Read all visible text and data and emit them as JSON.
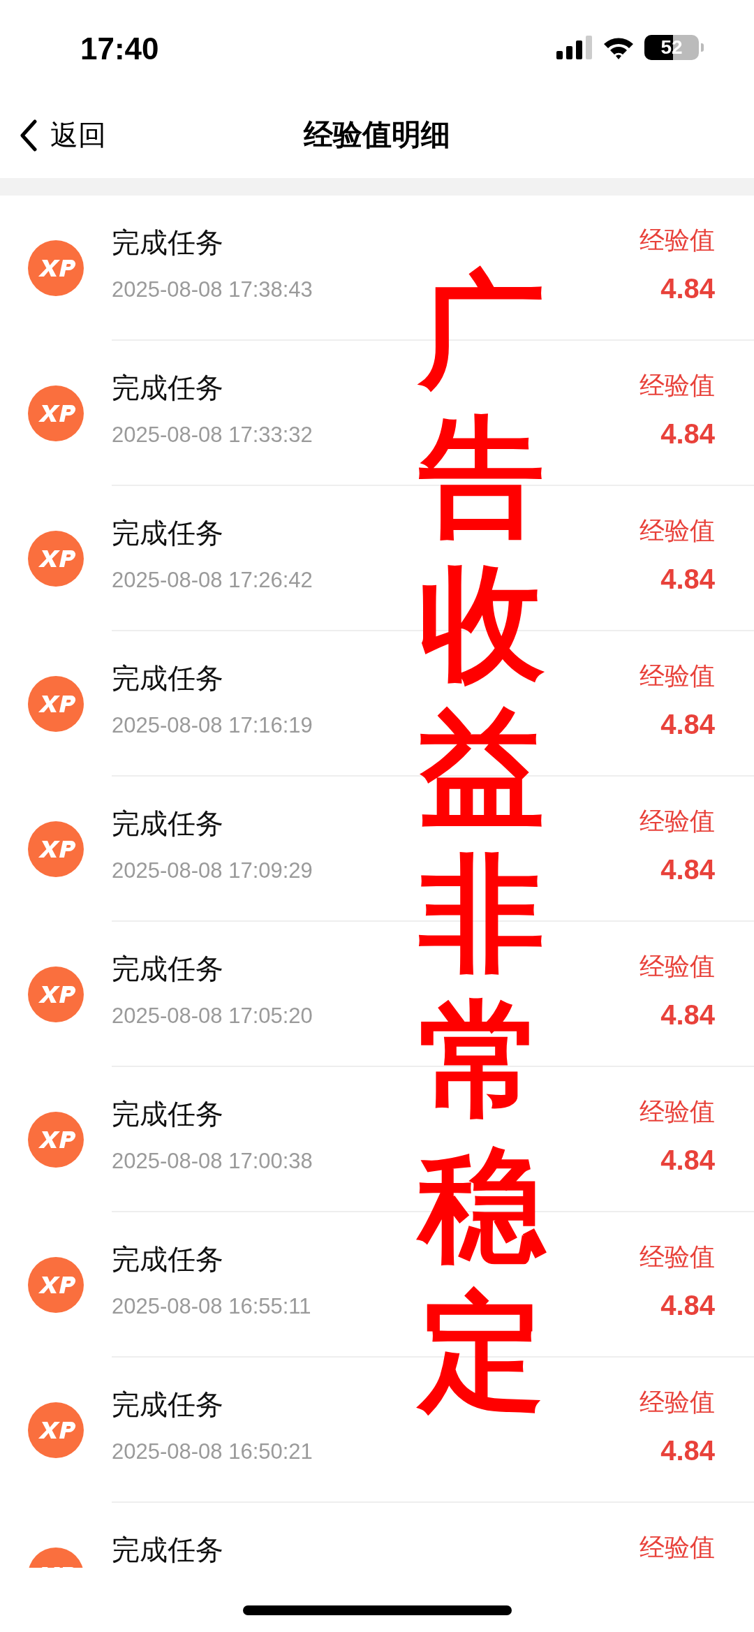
{
  "status_bar": {
    "time": "17:40",
    "battery": "52"
  },
  "nav": {
    "back": "返回",
    "title": "经验值明细"
  },
  "records": [
    {
      "title": "完成任务",
      "date": "2025-08-08 17:38:43",
      "label": "经验值",
      "value": "4.84"
    },
    {
      "title": "完成任务",
      "date": "2025-08-08 17:33:32",
      "label": "经验值",
      "value": "4.84"
    },
    {
      "title": "完成任务",
      "date": "2025-08-08 17:26:42",
      "label": "经验值",
      "value": "4.84"
    },
    {
      "title": "完成任务",
      "date": "2025-08-08 17:16:19",
      "label": "经验值",
      "value": "4.84"
    },
    {
      "title": "完成任务",
      "date": "2025-08-08 17:09:29",
      "label": "经验值",
      "value": "4.84"
    },
    {
      "title": "完成任务",
      "date": "2025-08-08 17:05:20",
      "label": "经验值",
      "value": "4.84"
    },
    {
      "title": "完成任务",
      "date": "2025-08-08 17:00:38",
      "label": "经验值",
      "value": "4.84"
    },
    {
      "title": "完成任务",
      "date": "2025-08-08 16:55:11",
      "label": "经验值",
      "value": "4.84"
    },
    {
      "title": "完成任务",
      "date": "2025-08-08 16:50:21",
      "label": "经验值",
      "value": "4.84"
    },
    {
      "title": "完成任务",
      "label": "经验值"
    }
  ],
  "overlay_text": "广告收益非常稳定"
}
